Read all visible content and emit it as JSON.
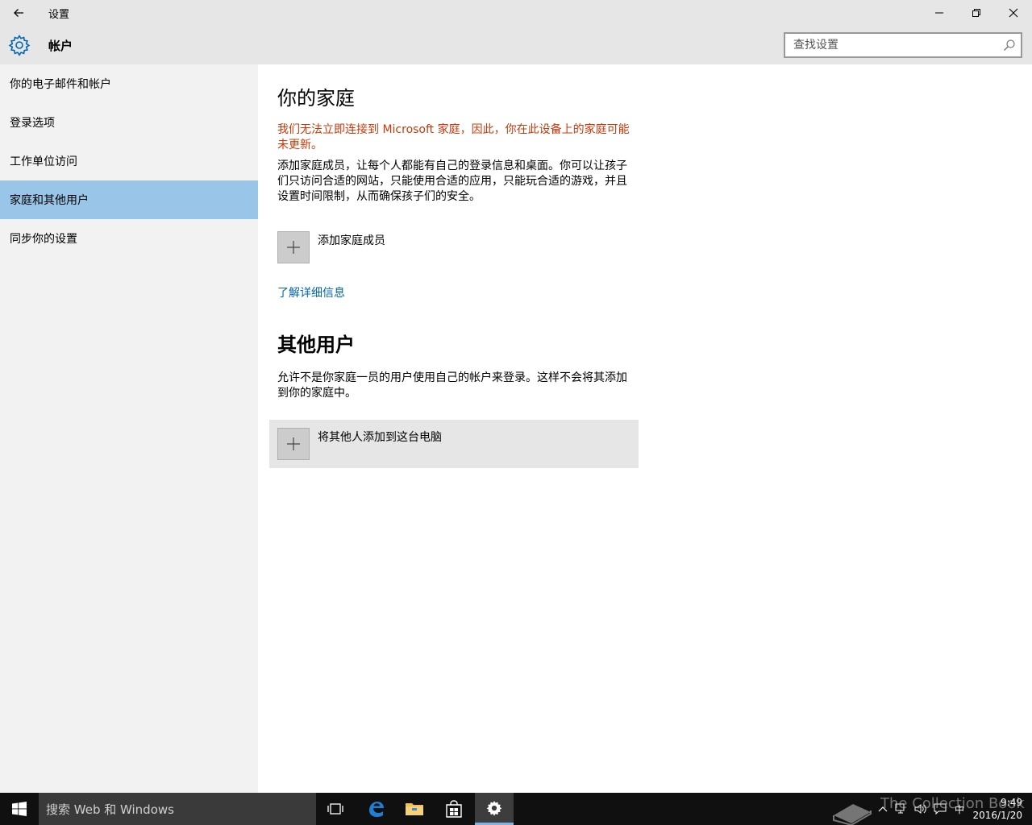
{
  "window": {
    "title": "设置",
    "section_title": "帐户"
  },
  "search": {
    "placeholder": "查找设置"
  },
  "sidebar": {
    "items": [
      {
        "label": "你的电子邮件和帐户"
      },
      {
        "label": "登录选项"
      },
      {
        "label": "工作单位访问"
      },
      {
        "label": "家庭和其他用户",
        "active": true
      },
      {
        "label": "同步你的设置"
      }
    ]
  },
  "main": {
    "family_heading": "你的家庭",
    "warning": "我们无法立即连接到 Microsoft 家庭，因此，你在此设备上的家庭可能未更新。",
    "family_desc": "添加家庭成员，让每个人都能有自己的登录信息和桌面。你可以让孩子们只访问合适的网站，只能使用合适的应用，只能玩合适的游戏，并且设置时间限制，从而确保孩子们的安全。",
    "add_family_label": "添加家庭成员",
    "learn_more": "了解详细信息",
    "others_heading": "其他用户",
    "others_desc": "允许不是你家庭一员的用户使用自己的帐户来登录。这样不会将其添加到你的家庭中。",
    "add_other_label": "将其他人添加到这台电脑"
  },
  "taskbar": {
    "search_placeholder": "搜索 Web 和 Windows",
    "ime": "中",
    "time": "9:49",
    "date": "2016/1/20",
    "watermark": "The Collection Book"
  },
  "colors": {
    "accent": "#0066b4",
    "warning": "#c9380a",
    "sidebar_active": "#99c5e8",
    "header_bg": "#e6e6e6"
  }
}
